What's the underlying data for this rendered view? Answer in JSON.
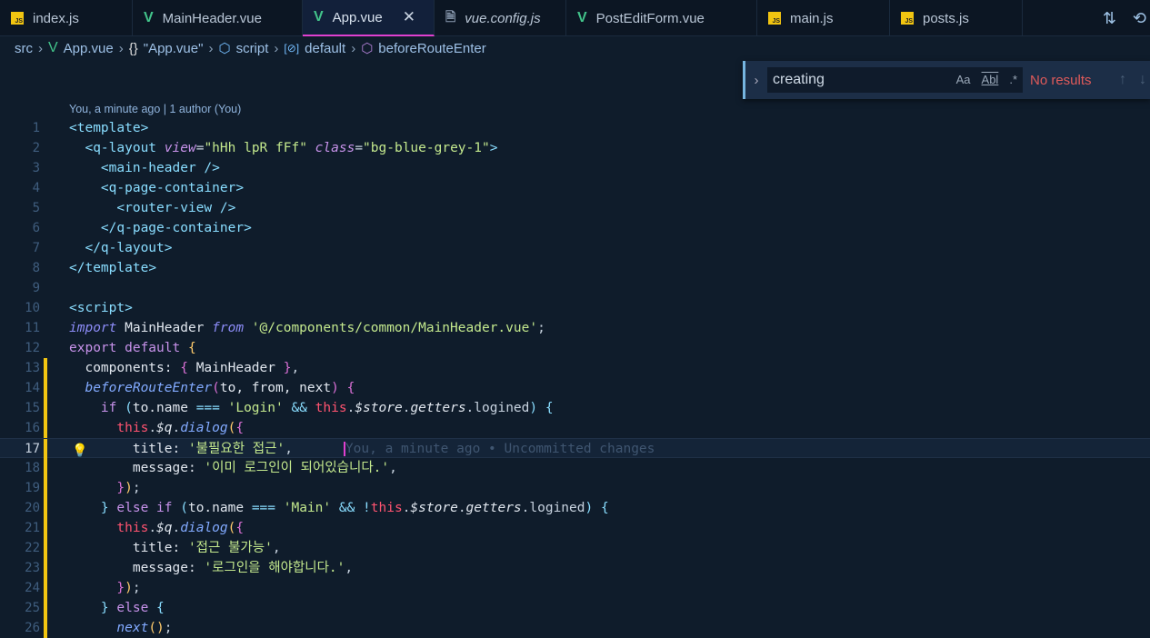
{
  "tabs": [
    {
      "label": "index.js",
      "icon": "js-icon",
      "w": 146
    },
    {
      "label": "MainHeader.vue",
      "icon": "vue-icon",
      "w": 187
    },
    {
      "label": "App.vue",
      "icon": "vue-icon",
      "w": 145,
      "active": true
    },
    {
      "label": "vue.config.js",
      "icon": "config-file-icon",
      "w": 145,
      "italic": true
    },
    {
      "label": "PostEditForm.vue",
      "icon": "vue-icon",
      "w": 210
    },
    {
      "label": "main.js",
      "icon": "js-icon",
      "w": 146
    },
    {
      "label": "posts.js",
      "icon": "js-icon",
      "w": 146
    }
  ],
  "breadcrumb": [
    "src",
    "App.vue",
    "\"App.vue\"",
    "script",
    "default",
    "beforeRouteEnter"
  ],
  "find": {
    "query": "creating",
    "match_case": "Aa",
    "whole_word": "Abl",
    "regex": ".*",
    "result": "No results"
  },
  "blame_header": "You, a minute ago | 1 author (You)",
  "inline_blame": "You, a minute ago • Uncommitted changes",
  "current_line": 17,
  "accent_color": "#e040d0",
  "lines": [
    [
      [
        "t-tag",
        "<"
      ],
      [
        "t-tn",
        "template"
      ],
      [
        "t-tag",
        ">"
      ]
    ],
    [
      [
        "t-tag",
        "  <"
      ],
      [
        "t-tn",
        "q-layout "
      ],
      [
        "t-attr",
        "view"
      ],
      [
        "t-p",
        "="
      ],
      [
        "t-str",
        "\"hHh lpR fFf\" "
      ],
      [
        "t-attr",
        "class"
      ],
      [
        "t-p",
        "="
      ],
      [
        "t-str",
        "\"bg-blue-grey-1\""
      ],
      [
        "t-tag",
        ">"
      ]
    ],
    [
      [
        "t-tag",
        "    <"
      ],
      [
        "t-tn",
        "main-header "
      ],
      [
        "t-tag",
        "/>"
      ]
    ],
    [
      [
        "t-tag",
        "    <"
      ],
      [
        "t-tn",
        "q-page-container"
      ],
      [
        "t-tag",
        ">"
      ]
    ],
    [
      [
        "t-tag",
        "      <"
      ],
      [
        "t-tn",
        "router-view "
      ],
      [
        "t-tag",
        "/>"
      ]
    ],
    [
      [
        "t-tag",
        "    </"
      ],
      [
        "t-tn",
        "q-page-container"
      ],
      [
        "t-tag",
        ">"
      ]
    ],
    [
      [
        "t-tag",
        "  </"
      ],
      [
        "t-tn",
        "q-layout"
      ],
      [
        "t-tag",
        ">"
      ]
    ],
    [
      [
        "t-tag",
        "</"
      ],
      [
        "t-tn",
        "template"
      ],
      [
        "t-tag",
        ">"
      ]
    ],
    [],
    [
      [
        "t-tag",
        "<"
      ],
      [
        "t-tn",
        "script"
      ],
      [
        "t-tag",
        ">"
      ]
    ],
    [
      [
        "t-kw",
        "import "
      ],
      [
        "t-prop",
        "MainHeader "
      ],
      [
        "t-kw",
        "from "
      ],
      [
        "t-str",
        "'@/components/common/MainHeader.vue'"
      ],
      [
        "t-p",
        ";"
      ]
    ],
    [
      [
        "t-kw2",
        "export default "
      ],
      [
        "t-br",
        "{"
      ]
    ],
    [
      [
        "t-prop",
        "  components: "
      ],
      [
        "t-br2",
        "{ "
      ],
      [
        "t-prop",
        "MainHeader "
      ],
      [
        "t-br2",
        "}"
      ],
      [
        "t-p",
        ","
      ]
    ],
    [
      [
        "t-fn",
        "  beforeRouteEnter"
      ],
      [
        "t-br2",
        "("
      ],
      [
        "t-prop",
        "to, from, next"
      ],
      [
        "t-br2",
        ")"
      ],
      [
        "t-p",
        " "
      ],
      [
        "t-br2",
        "{"
      ]
    ],
    [
      [
        "t-kw2",
        "    if "
      ],
      [
        "t-br3",
        "("
      ],
      [
        "t-prop",
        "to.name "
      ],
      [
        "t-op",
        "=== "
      ],
      [
        "t-str",
        "'Login' "
      ],
      [
        "t-op",
        "&& "
      ],
      [
        "t-this",
        "this"
      ],
      [
        "t-p",
        "."
      ],
      [
        "t-it",
        "$store"
      ],
      [
        "t-p",
        "."
      ],
      [
        "t-it",
        "getters"
      ],
      [
        "t-p",
        ".logined"
      ],
      [
        "t-br3",
        ")"
      ],
      [
        "t-p",
        " "
      ],
      [
        "t-br3",
        "{"
      ]
    ],
    [
      [
        "t-this",
        "      this"
      ],
      [
        "t-p",
        "."
      ],
      [
        "t-it",
        "$q"
      ],
      [
        "t-p",
        "."
      ],
      [
        "t-fn",
        "dialog"
      ],
      [
        "t-br",
        "("
      ],
      [
        "t-br2",
        "{"
      ]
    ],
    [
      [
        "t-prop",
        "        title: "
      ],
      [
        "t-str",
        "'불필요한 접근'"
      ],
      [
        "t-p",
        ","
      ]
    ],
    [
      [
        "t-prop",
        "        message: "
      ],
      [
        "t-str",
        "'이미 로그인이 되어있습니다.'"
      ],
      [
        "t-p",
        ","
      ]
    ],
    [
      [
        "t-br2",
        "      }"
      ],
      [
        "t-br",
        ")"
      ],
      [
        "t-p",
        ";"
      ]
    ],
    [
      [
        "t-br3",
        "    } "
      ],
      [
        "t-kw2",
        "else if "
      ],
      [
        "t-br3",
        "("
      ],
      [
        "t-prop",
        "to.name "
      ],
      [
        "t-op",
        "=== "
      ],
      [
        "t-str",
        "'Main' "
      ],
      [
        "t-op",
        "&& !"
      ],
      [
        "t-this",
        "this"
      ],
      [
        "t-p",
        "."
      ],
      [
        "t-it",
        "$store"
      ],
      [
        "t-p",
        "."
      ],
      [
        "t-it",
        "getters"
      ],
      [
        "t-p",
        ".logined"
      ],
      [
        "t-br3",
        ")"
      ],
      [
        "t-p",
        " "
      ],
      [
        "t-br3",
        "{"
      ]
    ],
    [
      [
        "t-this",
        "      this"
      ],
      [
        "t-p",
        "."
      ],
      [
        "t-it",
        "$q"
      ],
      [
        "t-p",
        "."
      ],
      [
        "t-fn",
        "dialog"
      ],
      [
        "t-br",
        "("
      ],
      [
        "t-br2",
        "{"
      ]
    ],
    [
      [
        "t-prop",
        "        title: "
      ],
      [
        "t-str",
        "'접근 불가능'"
      ],
      [
        "t-p",
        ","
      ]
    ],
    [
      [
        "t-prop",
        "        message: "
      ],
      [
        "t-str",
        "'로그인을 해야합니다.'"
      ],
      [
        "t-p",
        ","
      ]
    ],
    [
      [
        "t-br2",
        "      }"
      ],
      [
        "t-br",
        ")"
      ],
      [
        "t-p",
        ";"
      ]
    ],
    [
      [
        "t-br3",
        "    } "
      ],
      [
        "t-kw2",
        "else "
      ],
      [
        "t-br3",
        "{"
      ]
    ],
    [
      [
        "t-fn",
        "      next"
      ],
      [
        "t-br",
        "()"
      ],
      [
        "t-p",
        ";"
      ]
    ]
  ]
}
